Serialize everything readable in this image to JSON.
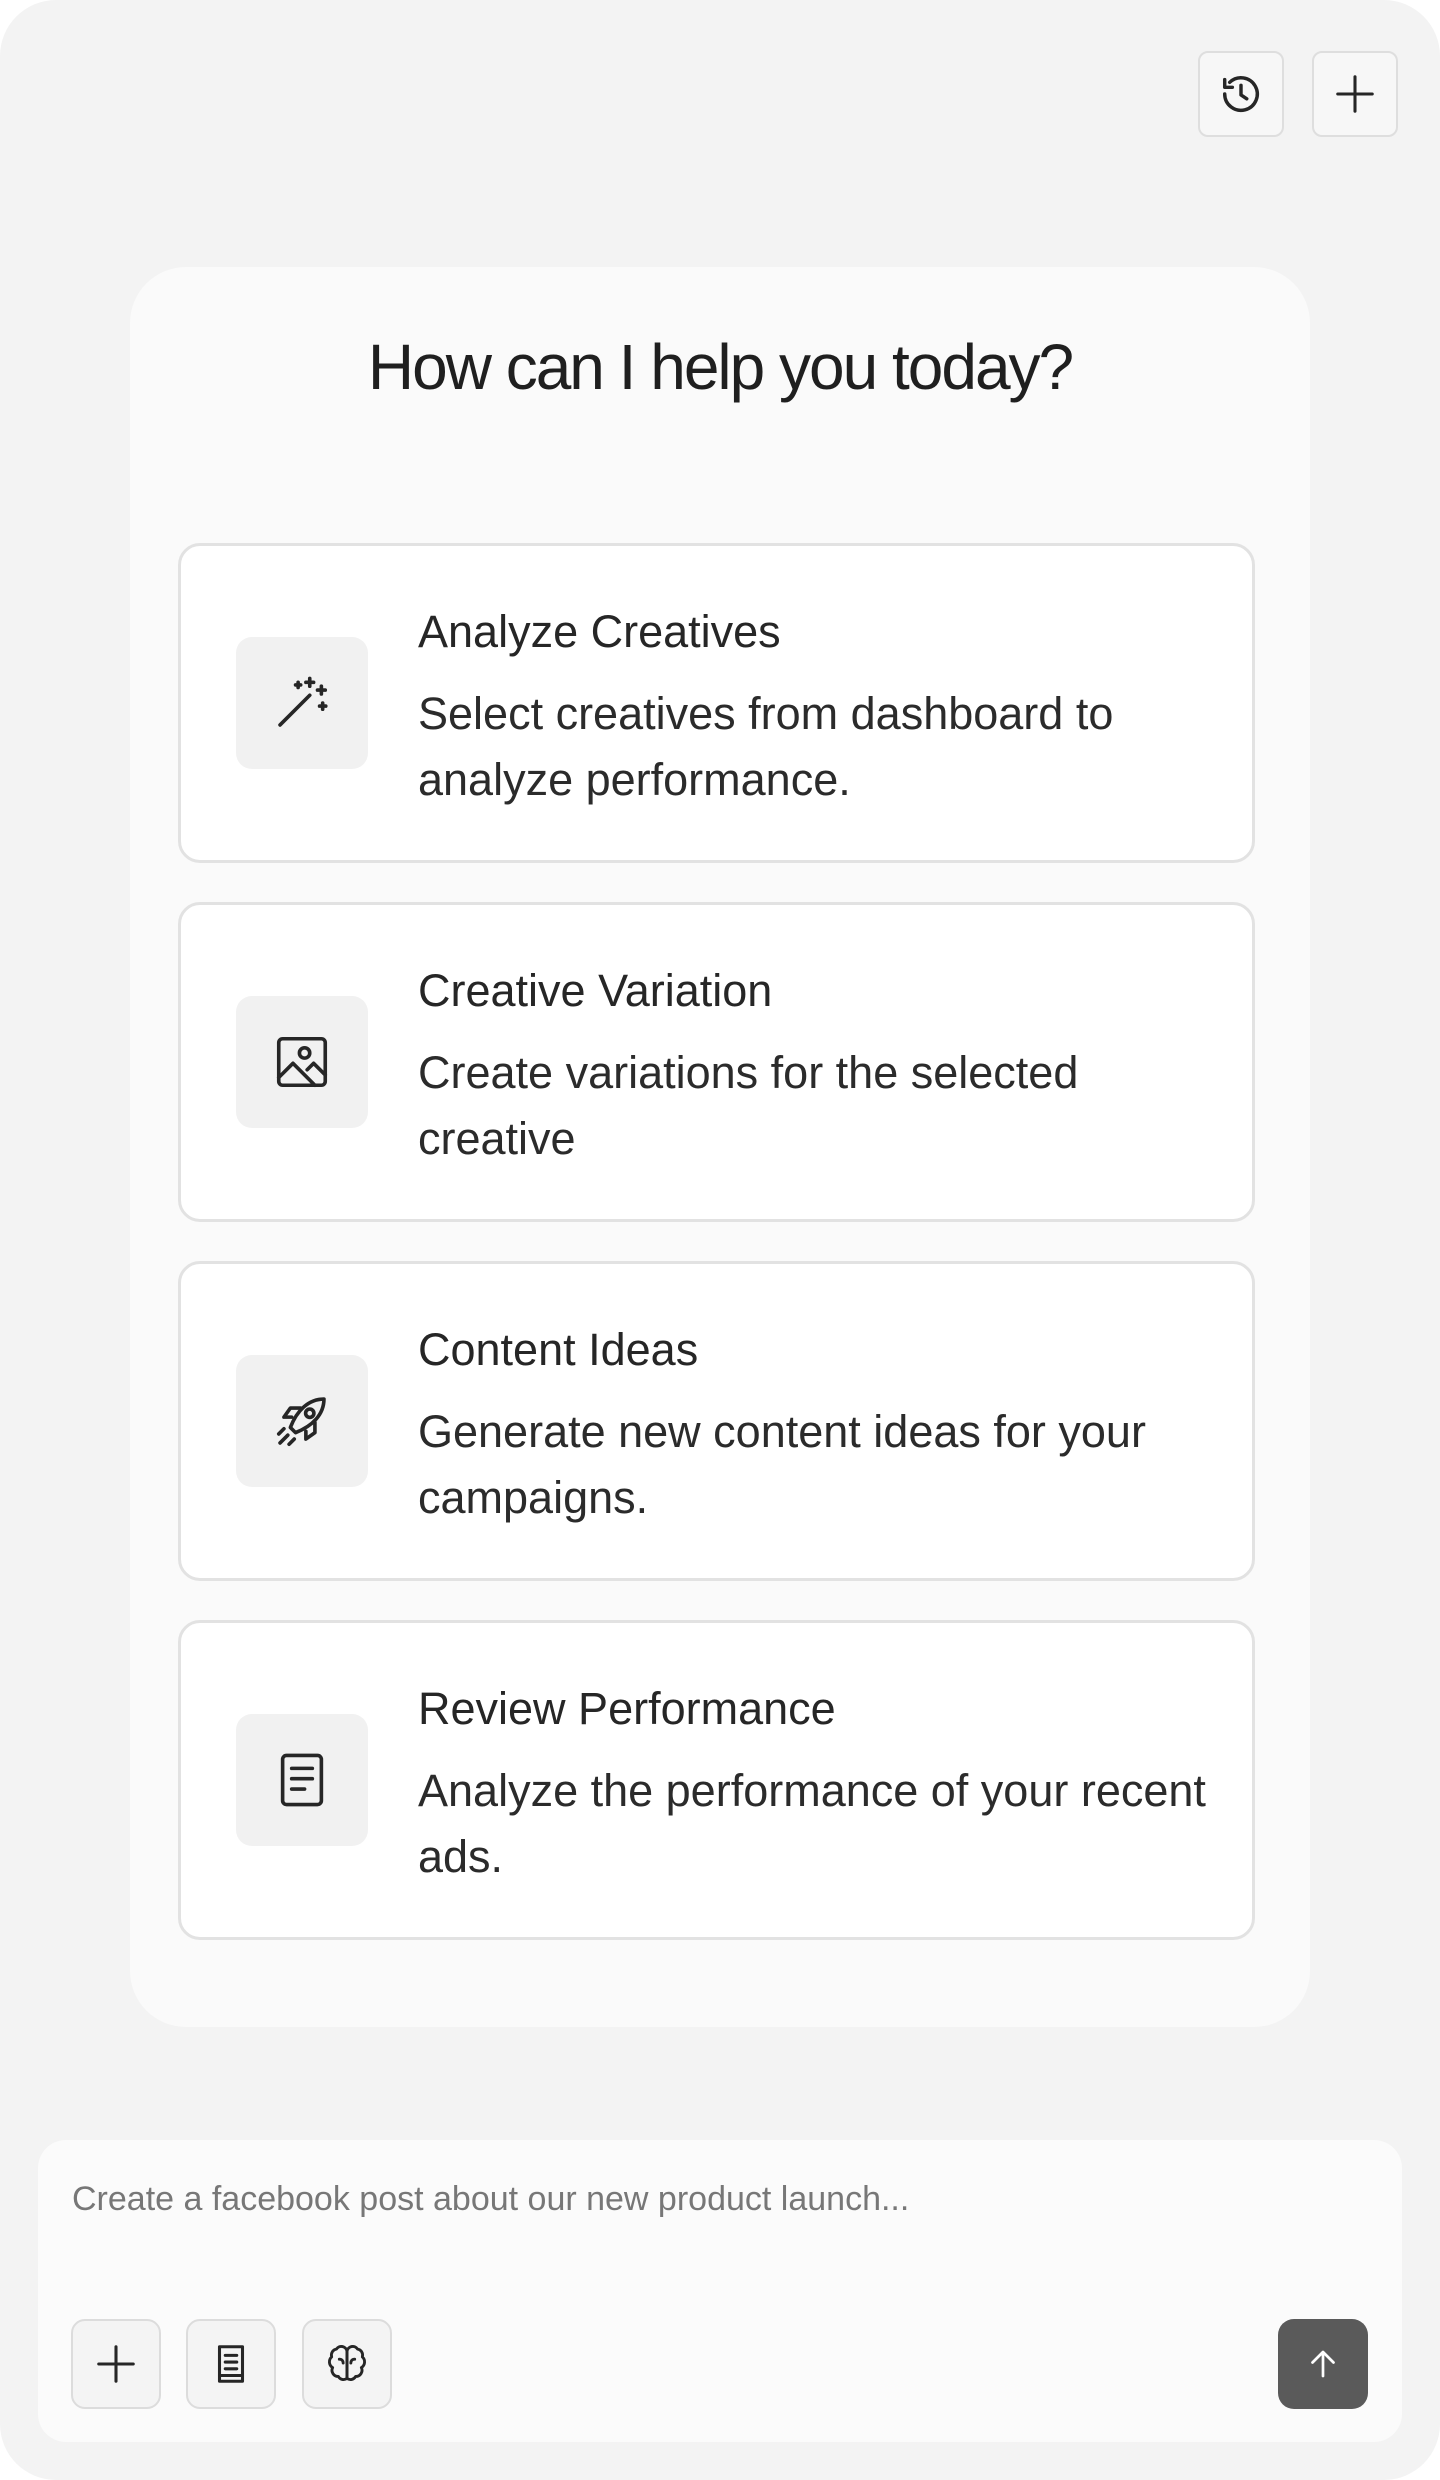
{
  "header": {
    "history_icon": "history-icon",
    "new_chat_icon": "plus-icon"
  },
  "main": {
    "headline": "How can I help you today?",
    "cards": [
      {
        "title": "Analyze Creatives",
        "description": "Select creatives from dashboard to analyze performance.",
        "icon": "magic-wand-icon"
      },
      {
        "title": "Creative Variation",
        "description": "Create variations for the selected creative",
        "icon": "image-icon"
      },
      {
        "title": "Content Ideas",
        "description": "Generate new content ideas for your campaigns.",
        "icon": "rocket-icon"
      },
      {
        "title": "Review Performance",
        "description": "Analyze the performance of your recent ads.",
        "icon": "document-icon"
      }
    ]
  },
  "composer": {
    "placeholder": "Create a facebook post about our new product launch...",
    "value": "",
    "tools": [
      "plus-icon",
      "notebook-icon",
      "brain-icon"
    ],
    "send_icon": "arrow-up-icon"
  },
  "colors": {
    "background": "#f3f3f3",
    "panel": "#fafafa",
    "card_border": "#e2e2e2",
    "icon_tile": "#f1f1f1",
    "send_button": "#5a5a5a"
  }
}
